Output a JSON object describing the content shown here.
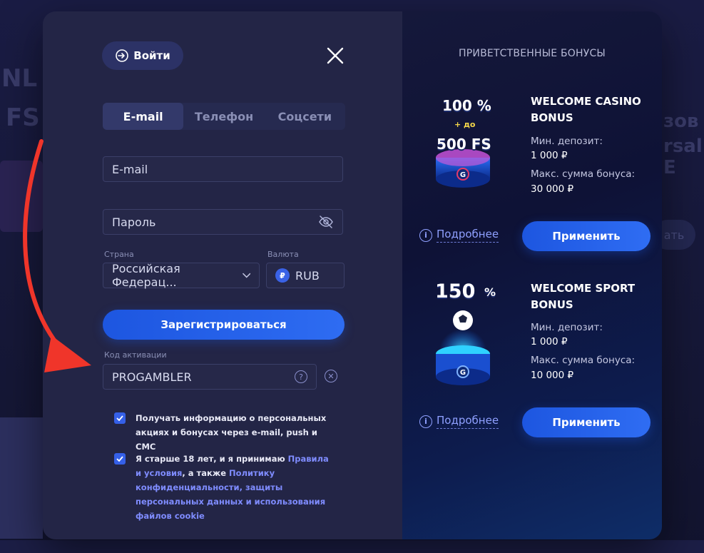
{
  "background": {
    "fragments": [
      "NL",
      "FS",
      "зов",
      "rsal E",
      "ать"
    ]
  },
  "login": {
    "label": "Войти"
  },
  "tabs": [
    {
      "label": "E-mail"
    },
    {
      "label": "Телефон"
    },
    {
      "label": "Соцсети"
    }
  ],
  "form": {
    "email_placeholder": "E-mail",
    "password_placeholder": "Пароль",
    "country_label": "Страна",
    "country_value": "Российская Федерац...",
    "currency_label": "Валюта",
    "currency_symbol": "₽",
    "currency_value": "RUB",
    "register_label": "Зарегистрироваться",
    "code_label": "Код активации",
    "code_value": "PROGAMBLER"
  },
  "checkboxes": {
    "promo_text": "Получать информацию о персональных акциях и бонусах через e-mail, push и СМС",
    "age_prefix": "Я старше 18 лет, и я принимаю ",
    "terms_link": "Правила и условия",
    "age_mid": ", а также ",
    "privacy_link": "Политику конфиденциальности, защиты персональных данных и использования файлов cookie"
  },
  "bonuses": {
    "title": "ПРИВЕТСТВЕННЫЕ БОНУСЫ",
    "casino": {
      "percent": "100 %",
      "plus": "+ до",
      "fs": "500 FS",
      "name": "WELCOME CASINO BONUS",
      "min_label": "Мин. депозит:",
      "min_value": "1 000 ₽",
      "max_label": "Макс. сумма бонуса:",
      "max_value": "30 000 ₽",
      "more_label": "Подробнее",
      "apply_label": "Применить"
    },
    "sport": {
      "percent_num": "150",
      "percent_sign": "%",
      "name": "WELCOME SPORT BONUS",
      "min_label": "Мин. депозит:",
      "min_value": "1 000 ₽",
      "max_label": "Макс. сумма бонуса:",
      "max_value": "10 000 ₽",
      "more_label": "Подробнее",
      "apply_label": "Применить"
    }
  },
  "colors": {
    "accent": "#2563eb",
    "panel": "#232546",
    "arrow": "#f0352a"
  }
}
